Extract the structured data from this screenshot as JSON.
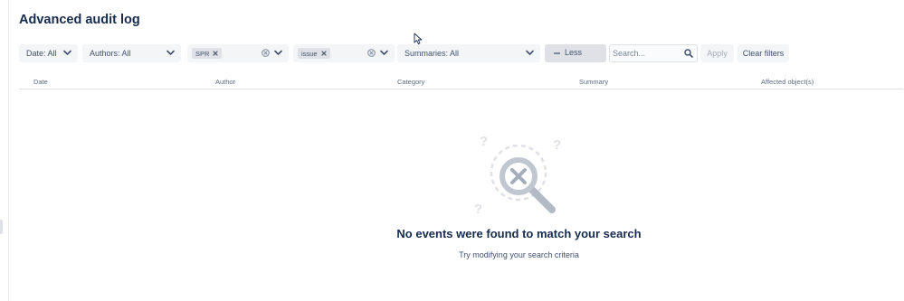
{
  "page": {
    "title": "Advanced audit log"
  },
  "filters": {
    "date": {
      "label": "Date: All"
    },
    "authors": {
      "label": "Authors: All"
    },
    "spr_filter": {
      "tag": "SPR"
    },
    "issue_filter": {
      "tag": "issue"
    },
    "summaries": {
      "label": "Summaries: All"
    },
    "less_label": "Less",
    "search": {
      "placeholder": "Search...",
      "value": ""
    },
    "apply_label": "Apply",
    "clear_label": "Clear filters"
  },
  "table": {
    "columns": [
      "Date",
      "Author",
      "Category",
      "Summary",
      "Affected object(s)"
    ]
  },
  "empty_state": {
    "title": "No events were found to match your search",
    "subtitle": "Try modifying your search criteria"
  },
  "icons": {
    "chevron": "chevron-down-icon",
    "clear": "clear-circle-icon",
    "tag_remove": "close-icon",
    "search": "search-icon",
    "minus": "minus-icon",
    "empty_illustration": "magnifier-x-icon",
    "cursor": "mouse-cursor"
  },
  "colors": {
    "text": "#172b4d",
    "subtle_text": "#42526e",
    "field_bg": "#f4f5f7",
    "disabled_text": "#a5adba",
    "illustration": "#c1c7d0"
  }
}
